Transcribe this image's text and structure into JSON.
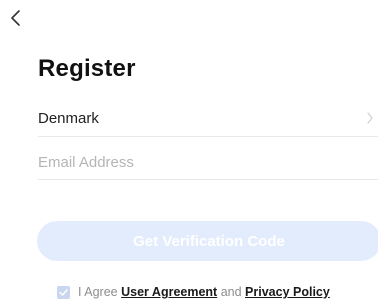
{
  "header": {
    "back_icon": "chevron-left-icon"
  },
  "page": {
    "title": "Register"
  },
  "form": {
    "country": {
      "value": "Denmark",
      "icon": "chevron-right-icon"
    },
    "email": {
      "placeholder": "Email Address",
      "value": ""
    },
    "submit_label": "Get Verification Code"
  },
  "agreement": {
    "checked": true,
    "prefix": "I Agree",
    "user_agreement": "User Agreement",
    "conjunction": "and",
    "privacy_policy": "Privacy Policy"
  },
  "colors": {
    "button_disabled": "#e3ecfd",
    "checkbox": "#c9d6f0",
    "divider": "#e9e9e9",
    "placeholder": "#b5b5b5"
  }
}
